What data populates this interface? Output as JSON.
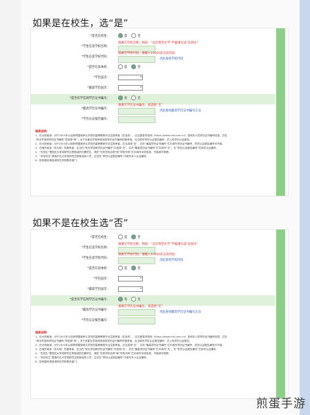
{
  "headings": {
    "in_school": "如果是在校生，选“是”",
    "not_in_school": "如果不是在校生选“否”"
  },
  "form1": {
    "rows": [
      {
        "label": "*是否在校生:",
        "kind": "radio",
        "opt1": "是",
        "opt2": "否",
        "selected": 1
      },
      {
        "label": "*学生在读学校名称:",
        "kind": "input",
        "hint": "请填写学校全称，例如：“北京师范大学”不能填写成“北师大”",
        "hint_color": "red"
      },
      {
        "label": "*学生在读学校代码:",
        "kind": "input",
        "hint": "请填写学校代码，请输入10000开头的代码",
        "hint_color": "red",
        "link": "点此查询学校代码"
      },
      {
        "label": "*是否在读本校:",
        "kind": "radio",
        "opt1": "是",
        "opt2": "否",
        "selected": 2
      },
      {
        "label": "*学历层次:",
        "kind": "select"
      },
      {
        "label": "*最高学历层次:",
        "kind": "select"
      },
      {
        "label": "*是否有学信网学历证书编号:",
        "kind": "radio",
        "opt1": "有",
        "opt2": "无",
        "selected": 1,
        "highlight": true
      },
      {
        "label": "*最高学历证书编号:",
        "kind": "input",
        "hint": "请填写学历证书编号，或选择“无”",
        "hint_color": "red",
        "link": "点此查询最高学历证书编号方法"
      },
      {
        "label": "*学历认证报告编号:",
        "kind": "input"
      }
    ],
    "notes_title": "填表说明:",
    "notes": [
      "1、在大陆就读：对于2001年以后获得国家承认学历的高等教育毕业生报考者（在读本），应当登录学信网（https://www.chsi.com.cn）查询本人的学历证书编号信息，并在",
      "“有无学信网学历证书编号”项选择“有”；对于未能在学信网查询到学历证书编号的报考者，应当填写学历认证报告编号，并上传学历认证报告。",
      "2、在大陆就读：对于2001年以前获得国家承认学历的高等教育毕业生报考者，应当选择“无”，并在“最高学历证书编号”栏中填写学历证书编号，学历认证报告编号可不填。",
      "3、在境外就读（非大陆）的报考者，应当在“有无学信网学历证书编号”中选择“无”，并在“最高学历证书编号”栏中填写“无”，在“学历认证报告编号”栏填写认证编号。",
      "4、“在校生”是指在大学或研究生院就读的在籍学生，请在“在校学校名称”和“学校代码”栏中填写本校信息，不能填写简称。",
      "5、“非在校生”是指不在大学或研究生院就读的人员，应当在“学历认证报告编号”中填写本人认证编号。",
      "6、如有疑问请咨询所在学校教务部门。"
    ]
  },
  "form2": {
    "rows": [
      {
        "label": "*是否在校生:",
        "kind": "radio",
        "opt1": "是",
        "opt2": "否",
        "selected": 2
      },
      {
        "label": "*学生在读学校名称:",
        "kind": "input",
        "hint": "请填写学校全称，例如：“北京师范大学”不能填写成“北师大”",
        "hint_color": "red"
      },
      {
        "label": "*学生在读学校代码:",
        "kind": "input",
        "hint": "请填写学校代码，请输入10000开头的代码",
        "hint_color": "red",
        "link": "点此查询学校代码"
      },
      {
        "label": "*是否在读本校:",
        "kind": "radio",
        "opt1": "是",
        "opt2": "否",
        "selected": 2
      },
      {
        "label": "*学历层次:",
        "kind": "select"
      },
      {
        "label": "*最高学历层次:",
        "kind": "select"
      },
      {
        "label": "*是否有学信网学历证书编号:",
        "kind": "radio",
        "opt1": "有",
        "opt2": "无",
        "selected": 1,
        "highlight": true
      },
      {
        "label": "*最高学历证书编号:",
        "kind": "input",
        "hint": "请填写学历证书编号，或选择“无”",
        "hint_color": "red",
        "link": "点此查询最高学历证书编号方法"
      },
      {
        "label": "*学历认证报告编号:",
        "kind": "input"
      }
    ],
    "notes_title": "填表说明:",
    "notes": [
      "1、在大陆就读：对于2001年以后获得国家承认学历的高等教育毕业生报考者（在读本），应当登录学信网（https://www.chsi.com.cn）查询本人的学历证书编号信息，并在",
      "“有无学信网学历证书编号”项选择“有”；对于未能在学信网查询到学历证书编号的报考者，应当填写学历认证报告编号，并上传学历认证报告。",
      "2、在大陆就读：对于2001年以前获得国家承认学历的高等教育毕业生报考者，应当选择“无”，并在“最高学历证书编号”栏中填写学历证书编号，学历认证报告编号可不填。",
      "3、在境外就读（非大陆）的报考者，应当在“有无学信网学历证书编号”中选择“无”，并在“最高学历证书编号”栏中填写“无”，在“学历认证报告编号”栏填写认证编号。",
      "4、“在校生”是指在大学或研究生院就读的在籍学生，请在“在校学校名称”和“学校代码”栏中填写本校信息，不能填写简称。",
      "5、“非在校生”是指不在大学或研究生院就读的人员，应当在“学历认证报告编号”中填写本人认证编号。",
      "6、如有疑问请咨询所在学校教务部门。"
    ]
  },
  "watermark": "煎蛋手游",
  "colors": {
    "accent_green": "#8fce8a",
    "hint_red": "#dd3333",
    "link_blue": "#3960b6"
  }
}
